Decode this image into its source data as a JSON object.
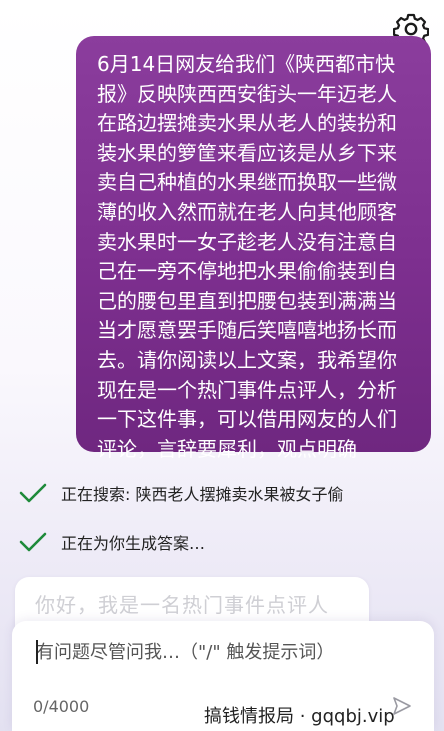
{
  "header": {
    "settings_icon": "gear-icon"
  },
  "conversation": {
    "user_message": "6月14日网友给我们《陕西都市快报》反映陕西西安街头一年迈老人在路边摆摊卖水果从老人的装扮和装水果的箩筐来看应该是从乡下来卖自己种植的水果继而换取一些微薄的收入然而就在老人向其他顾客卖水果时一女子趁老人没有注意自己在一旁不停地把水果偷偷装到自己的腰包里直到把腰包装到满满当当才愿意罢手随后笑嘻嘻地扬长而去。请你阅读以上文案，我希望你现在是一个热门事件点评人，分析一下这件事，可以借用网友的人们评论，言辞要犀利，观点明确",
    "status": [
      {
        "icon": "checkmark-icon",
        "text": "正在搜索: 陕西老人摆摊卖水果被女子偷"
      },
      {
        "icon": "checkmark-icon",
        "text": "正在为你生成答案…"
      }
    ],
    "answer_preview": "你好，我是一名热门事件点评人"
  },
  "composer": {
    "placeholder": "有问题尽管问我…（\"/\" 触发提示词）",
    "value": "",
    "char_count": "0/4000",
    "send_icon": "send-icon"
  },
  "watermark": "搞钱情报局 · gqqbj.vip",
  "colors": {
    "bubble_start": "#8b3d9d",
    "bubble_end": "#6f2780",
    "check_green": "#1e8a3a",
    "bubble_text": "#ffffff"
  }
}
